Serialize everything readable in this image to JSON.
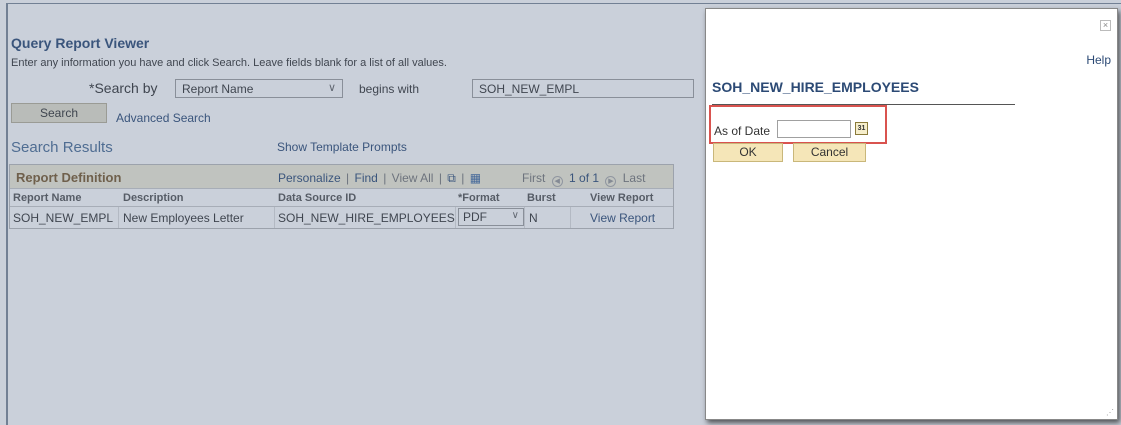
{
  "page": {
    "title": "Query Report Viewer",
    "instructions": "Enter any information you have and click Search. Leave fields blank for a list of all values.",
    "search_by_label": "*Search by",
    "search_by_value": "Report Name",
    "operator_label": "begins with",
    "search_value": "SOH_NEW_EMPL",
    "search_button": "Search",
    "advanced_search": "Advanced Search",
    "results_header": "Search Results",
    "show_template_prompts": "Show Template Prompts"
  },
  "grid": {
    "caption": "Report Definition",
    "personalize": "Personalize",
    "find": "Find",
    "view_all": "View All",
    "first": "First",
    "page_info": "1 of 1",
    "last": "Last",
    "columns": [
      "Report Name",
      "Description",
      "Data Source ID",
      "*Format",
      "Burst",
      "View Report"
    ],
    "rows": [
      {
        "report_name": "SOH_NEW_EMPL",
        "description": "New Employees Letter",
        "data_source_id": "SOH_NEW_HIRE_EMPLOYEES",
        "format": "PDF",
        "burst": "N",
        "view_report": "View Report"
      }
    ]
  },
  "modal": {
    "help": "Help",
    "title": "SOH_NEW_HIRE_EMPLOYEES",
    "date_label": "As of Date",
    "date_value": "",
    "ok": "OK",
    "cancel": "Cancel",
    "close_glyph": "×",
    "calendar_glyph": "31"
  },
  "colors": {
    "link": "#2c4a75",
    "highlight": "#d9534f",
    "button": "#f5e6b8"
  }
}
